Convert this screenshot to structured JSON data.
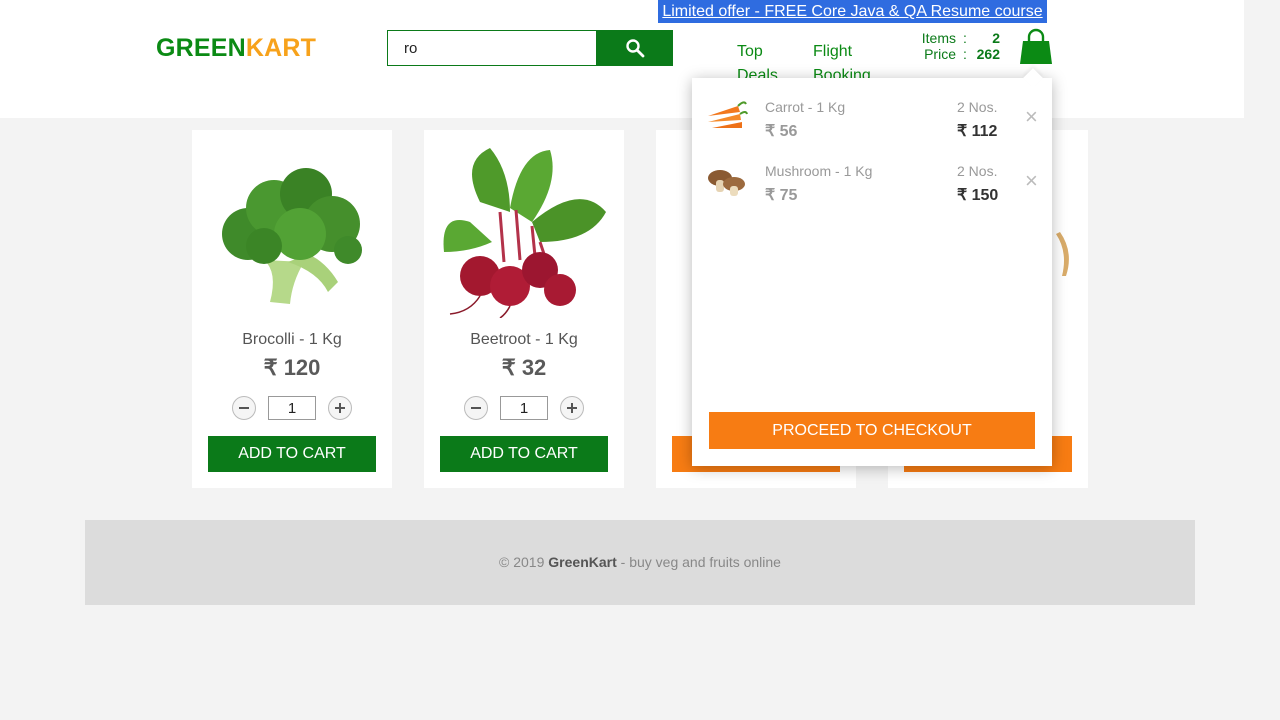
{
  "brand": {
    "part1": "GREEN",
    "part2": "KART"
  },
  "search": {
    "value": "ro",
    "button_icon": "search-icon"
  },
  "offer": {
    "text": "Limited offer - FREE Core Java & QA Resume course"
  },
  "nav": {
    "top_deals": "Top Deals",
    "flight_booking": "Flight Booking"
  },
  "cart_stats": {
    "items_label": "Items",
    "items_value": "2",
    "price_label": "Price",
    "price_value": "262",
    "separator": ":"
  },
  "products": [
    {
      "name": "Brocolli - 1 Kg",
      "price": "₹ 120",
      "qty": "1",
      "button": "ADD TO CART"
    },
    {
      "name": "Beetroot - 1 Kg",
      "price": "₹ 32",
      "qty": "1",
      "button": "ADD TO CART"
    },
    {
      "button": "ADD TO CART"
    },
    {
      "button": "ADD TO CART"
    }
  ],
  "cart_preview": {
    "items": [
      {
        "name": "Carrot - 1 Kg",
        "price": "₹ 56",
        "nos": "2 Nos.",
        "amount": "₹ 112",
        "remove": "×"
      },
      {
        "name": "Mushroom - 1 Kg",
        "price": "₹ 75",
        "nos": "2 Nos.",
        "amount": "₹ 150",
        "remove": "×"
      }
    ],
    "checkout_label": "PROCEED TO CHECKOUT"
  },
  "footer": {
    "year": "© 2019",
    "brand": "GreenKart",
    "tagline": "- buy veg and fruits online"
  },
  "colors": {
    "green": "#0b7a19",
    "orange": "#f77c13",
    "brand_orange": "#f7a21b",
    "offer_blue": "#2f6ce0"
  }
}
